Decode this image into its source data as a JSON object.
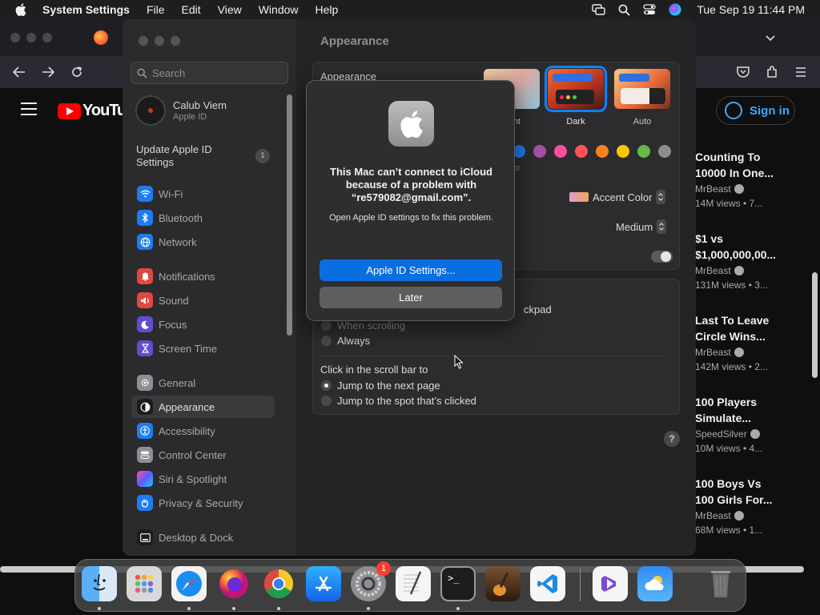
{
  "menubar": {
    "app_name": "System Settings",
    "items": [
      "File",
      "Edit",
      "View",
      "Window",
      "Help"
    ],
    "clock": "Tue Sep 19  11:44 PM"
  },
  "browser": {
    "youtube_wordmark": "YouTube",
    "sign_in": "Sign in",
    "videos": [
      {
        "title": "Counting To 10000 In One...",
        "channel": "MrBeast",
        "views": "14M views • 7..."
      },
      {
        "title": "$1 vs $1,000,000,00...",
        "channel": "MrBeast",
        "views": "131M views • 3..."
      },
      {
        "title": "Last To Leave Circle Wins...",
        "channel": "MrBeast",
        "views": "142M views • 2..."
      },
      {
        "title": "100 Players Simulate...",
        "channel": "SpeedSilver",
        "views": "10M views • 4..."
      },
      {
        "title": "100 Boys Vs 100 Girls For...",
        "channel": "MrBeast",
        "views": "68M views • 1..."
      }
    ]
  },
  "sidebar": {
    "search_placeholder": "Search",
    "account_name": "Calub Viem",
    "account_sub": "Apple ID",
    "update_text": "Update Apple ID Settings",
    "update_badge": "1",
    "items": [
      {
        "label": "Wi-Fi",
        "color": "#1e7cf2"
      },
      {
        "label": "Bluetooth",
        "color": "#1e7cf2"
      },
      {
        "label": "Network",
        "color": "#1e7cf2"
      },
      {
        "label": "Notifications",
        "color": "#e0483e"
      },
      {
        "label": "Sound",
        "color": "#e0483e"
      },
      {
        "label": "Focus",
        "color": "#5e4fd1"
      },
      {
        "label": "Screen Time",
        "color": "#5e4fd1"
      },
      {
        "label": "General",
        "color": "#8e8e93"
      },
      {
        "label": "Appearance",
        "color": "#3a3a3c"
      },
      {
        "label": "Accessibility",
        "color": "#1e7cf2"
      },
      {
        "label": "Control Center",
        "color": "#8e8e93"
      },
      {
        "label": "Siri & Spotlight",
        "color": "#b04fd6"
      },
      {
        "label": "Privacy & Security",
        "color": "#1e7cf2"
      },
      {
        "label": "Desktop & Dock",
        "color": "#3a3a3c"
      }
    ]
  },
  "content": {
    "title": "Appearance",
    "appearance_label": "Appearance",
    "themes": [
      {
        "label": "nt"
      },
      {
        "label": "Dark"
      },
      {
        "label": "Auto"
      }
    ],
    "accent_colors": [
      "#1e7cf2",
      "#a550a7",
      "#f74f9e",
      "#ff5257",
      "#f7821b",
      "#ffc600",
      "#62ba46",
      "#8c8c8c"
    ],
    "accent_fragment": "or",
    "highlight_label": "Accent Color",
    "sidebar_icon_size": "Medium",
    "scroll_fragment": "ckpad",
    "show_scroll_options": [
      "When scrolling",
      "Always"
    ],
    "click_scroll_label": "Click in the scroll bar to",
    "click_scroll_options": [
      "Jump to the next page",
      "Jump to the spot that’s clicked"
    ],
    "help": "?"
  },
  "dialog": {
    "title": "This Mac can’t connect to iCloud because of a problem with “re579082@gmail.com”.",
    "message": "Open Apple ID settings to fix this problem.",
    "primary": "Apple ID Settings...",
    "secondary": "Later"
  },
  "dock": {
    "apps": [
      "Finder",
      "Launchpad",
      "Safari",
      "Firefox",
      "Chrome",
      "App Store",
      "System Settings",
      "TextEdit",
      "Terminal",
      "GarageBand",
      "Visual Studio Code",
      "Visual Studio",
      "Weather",
      "Trash"
    ],
    "settings_badge": "1"
  }
}
